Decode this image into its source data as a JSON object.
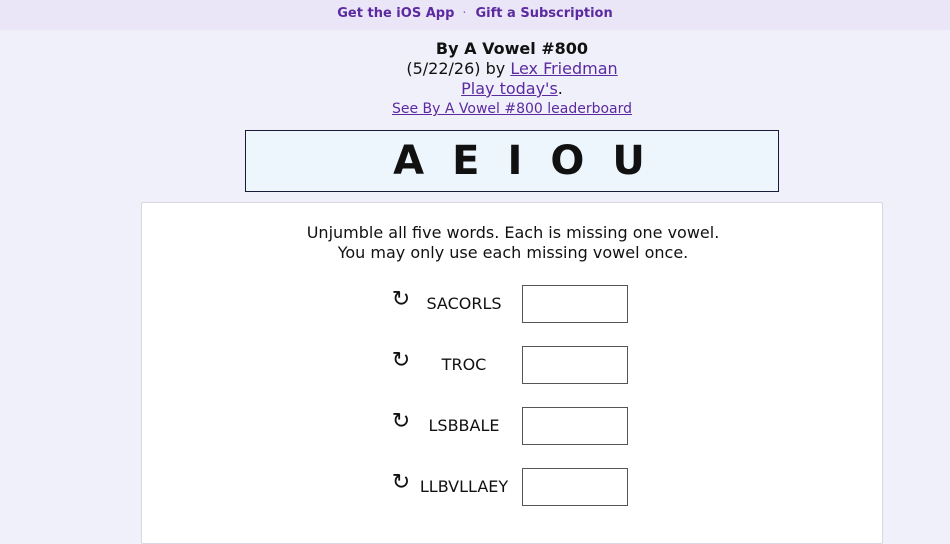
{
  "topbar": {
    "ios_app": "Get the iOS App",
    "separator": "·",
    "gift": "Gift a Subscription"
  },
  "header": {
    "title": "By A Vowel #800",
    "date": "(5/22/26) by ",
    "author": "Lex Friedman",
    "play_today": "Play today's",
    "period": ".",
    "leaderboard": "See By A Vowel #800 leaderboard"
  },
  "vowels": [
    "A",
    "E",
    "I",
    "O",
    "U"
  ],
  "instructions": {
    "line1": "Unjumble all five words. Each is missing one vowel.",
    "line2": "You may only use each missing vowel once."
  },
  "puzzle": {
    "shuffle_icon": "↻",
    "words": [
      "SACORLS",
      "TROC",
      "LSBBALE",
      "LLBVLLAEY"
    ]
  }
}
